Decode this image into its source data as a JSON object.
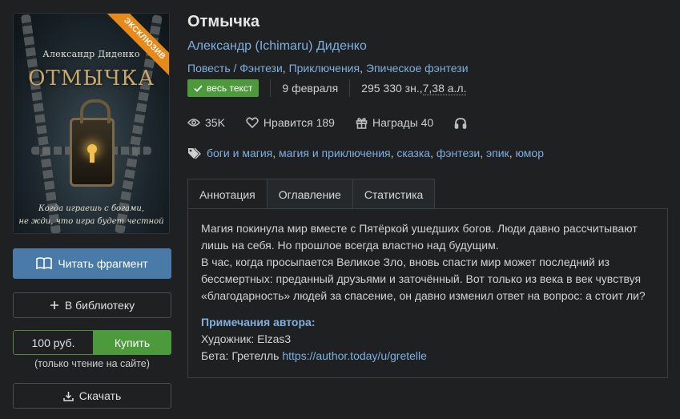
{
  "cover": {
    "author": "Александр Диденко",
    "title": "ОТМЫЧКА",
    "tagline_1": "Когда играешь с богами,",
    "tagline_2": "не жди, что игра будет честной",
    "ribbon": "ЭКСКЛЮЗИВ"
  },
  "actions": {
    "read_label": "Читать фрагмент",
    "library_label": "В библиотеку",
    "price": "100 руб.",
    "buy_label": "Купить",
    "buy_note": "(только чтение на сайте)",
    "download_label": "Скачать"
  },
  "book": {
    "title": "Отмычка",
    "author": "Александр (Ichimaru) Диденко",
    "genres": [
      "Повесть / Фэнтези",
      "Приключения",
      "Эпическое фэнтези"
    ],
    "status_badge": "весь текст",
    "date": "9 февраля",
    "size_chars": "295 330 зн., ",
    "size_al": "7,38 а.л."
  },
  "stats": {
    "views": "35K",
    "likes": "Нравится 189",
    "awards": "Награды 40"
  },
  "tags": [
    "боги и магия",
    "магия и приключения",
    "сказка",
    "фэнтези",
    "эпик",
    "юмор"
  ],
  "tabs": {
    "annotation": "Аннотация",
    "toc": "Оглавление",
    "statistics": "Статистика"
  },
  "annotation": {
    "p1": "Магия покинула мир вместе с Пятёркой ушедших богов. Люди давно рассчитывают лишь на себя. Но прошлое всегда властно над будущим.",
    "p2": "В час, когда просыпается Великое Зло, вновь спасти мир может последний из бессмертных: преданный друзьями и заточённый. Вот только из века в век чувствуя «благодарность» людей за спасение, он давно изменил ответ на вопрос: а стоит ли?",
    "notes_title": "Примечания автора:",
    "artist": "Художник: Elzas3",
    "beta_prefix": "Бета: Гретелль ",
    "beta_link": "https://author.today/u/gretelle"
  }
}
